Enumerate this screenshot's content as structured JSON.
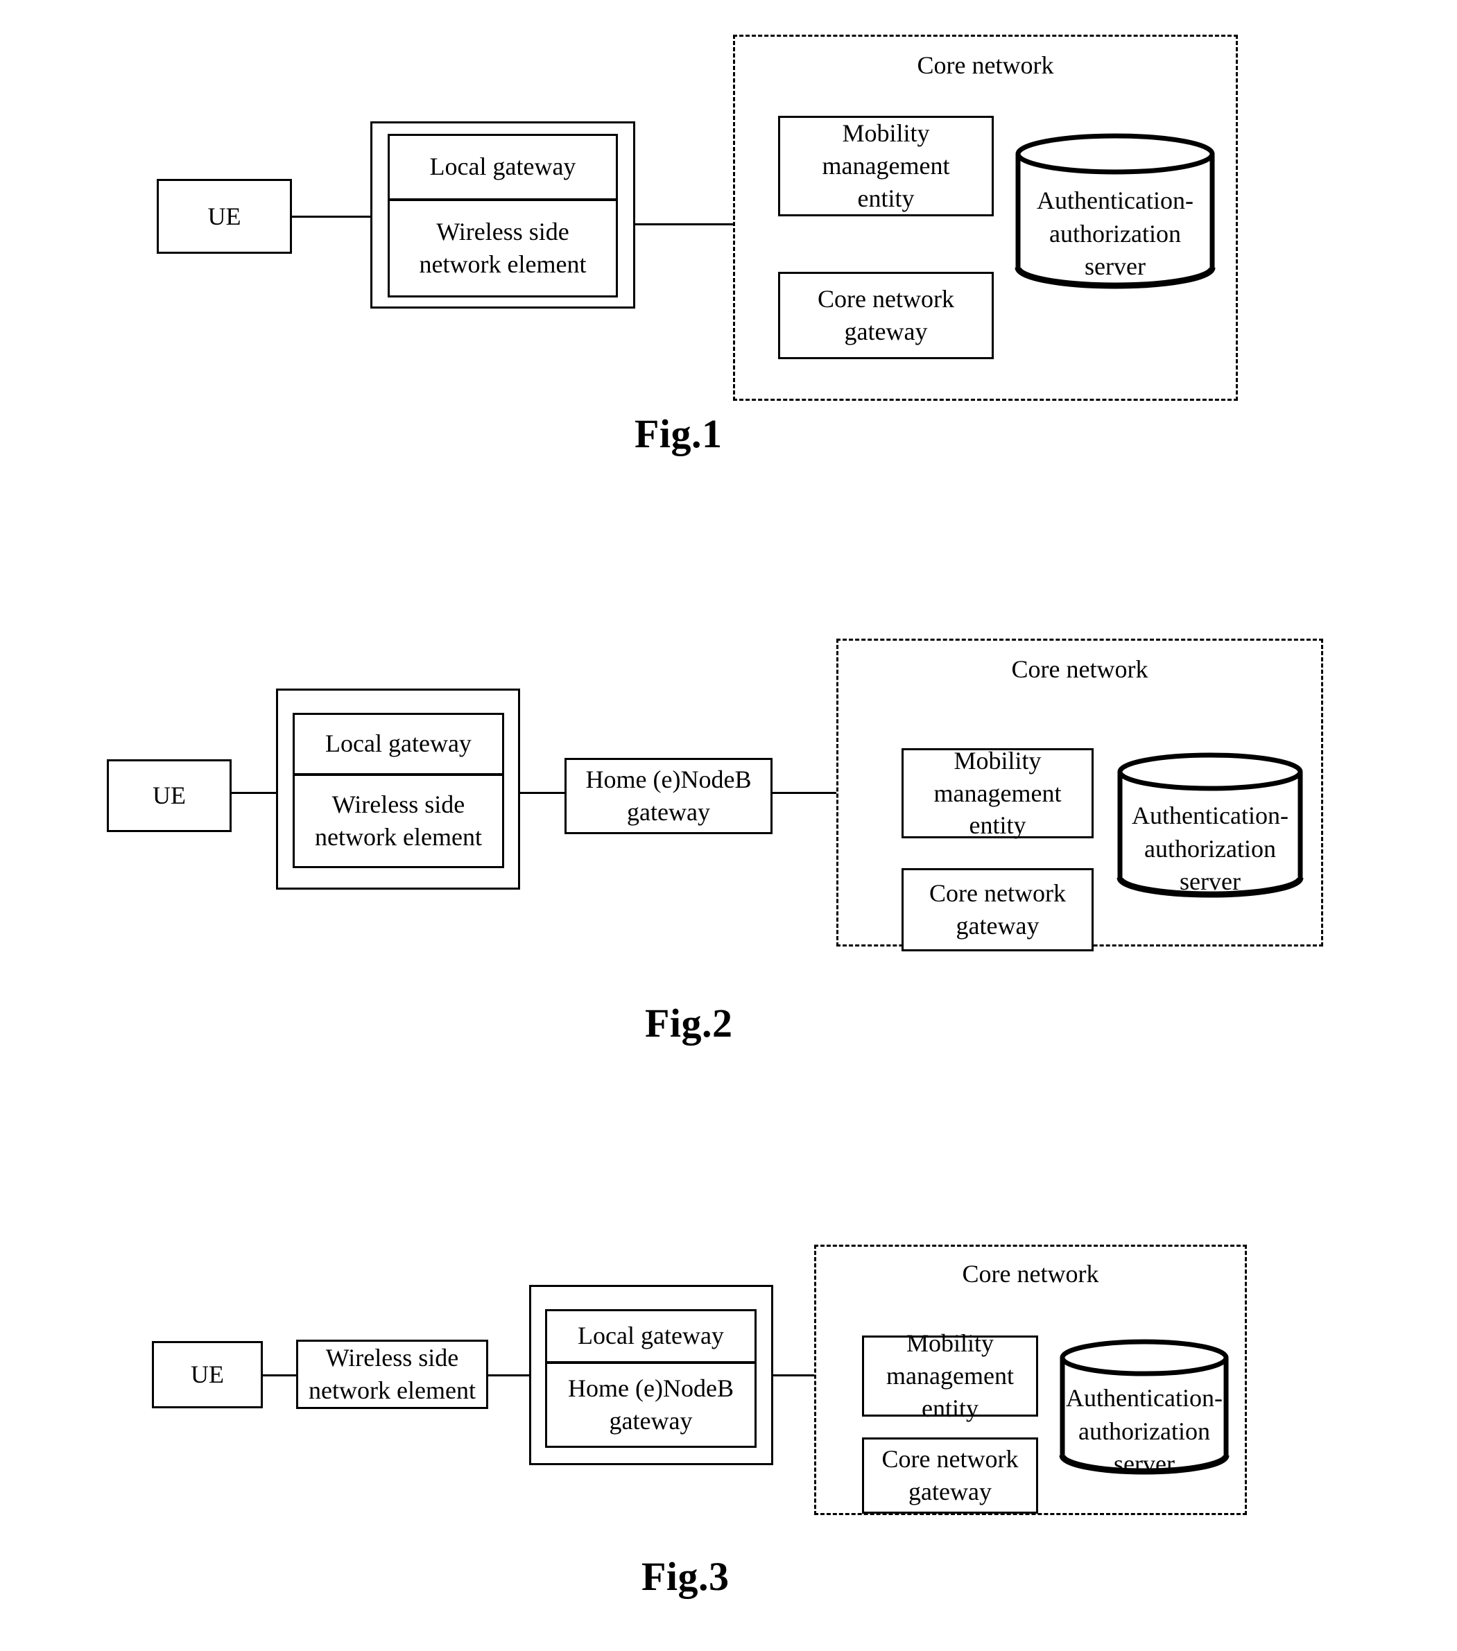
{
  "document": {
    "type": "patent-drawing-sheet",
    "figure_captions": [
      "Fig.1",
      "Fig.2",
      "Fig.3"
    ]
  },
  "common": {
    "ue_label": "UE",
    "local_gateway_label": "Local gateway",
    "wireless_side_network_element_label": "Wireless side\nnetwork element",
    "home_enodeb_gateway_label": "Home (e)NodeB\ngateway",
    "home_enodeb_gateway_spaced_label": "Home  (e)NodeB\ngateway",
    "core_network_title": "Core network",
    "mobility_management_entity_label": "Mobility\nmanagement\nentity",
    "core_network_gateway_label": "Core network\ngateway",
    "auth_server_label": "Authentication-\nauthorization\nserver",
    "stroke_color": "#000000",
    "background_color": "#ffffff"
  },
  "fig1": {
    "caption": "Fig.1",
    "ue": {
      "label": "UE"
    },
    "gateway_group": {
      "top_label": "Local gateway",
      "bottom_label": "Wireless side\nnetwork element"
    },
    "core_network": {
      "title": "Core network",
      "mme_label": "Mobility\nmanagement\nentity",
      "cn_gateway_label": "Core network\ngateway",
      "auth_server_label": "Authentication-\nauthorization\nserver"
    }
  },
  "fig2": {
    "caption": "Fig.2",
    "ue": {
      "label": "UE"
    },
    "gateway_group": {
      "top_label": "Local gateway",
      "bottom_label": "Wireless side\nnetwork element"
    },
    "henb_gateway": {
      "label": "Home  (e)NodeB\ngateway"
    },
    "core_network": {
      "title": "Core network",
      "mme_label": "Mobility\nmanagement\nentity",
      "cn_gateway_label": "Core network\ngateway",
      "auth_server_label": "Authentication-\nauthorization\nserver"
    }
  },
  "fig3": {
    "caption": "Fig.3",
    "ue": {
      "label": "UE"
    },
    "wireless_side_network_element": {
      "label": "Wireless side\nnetwork element"
    },
    "gateway_group": {
      "top_label": "Local gateway",
      "bottom_label": "Home (e)NodeB\ngateway"
    },
    "core_network": {
      "title": "Core network",
      "mme_label": "Mobility\nmanagement\nentity",
      "cn_gateway_label": "Core network\ngateway",
      "auth_server_label": "Authentication-\nauthorization\nserver"
    }
  }
}
